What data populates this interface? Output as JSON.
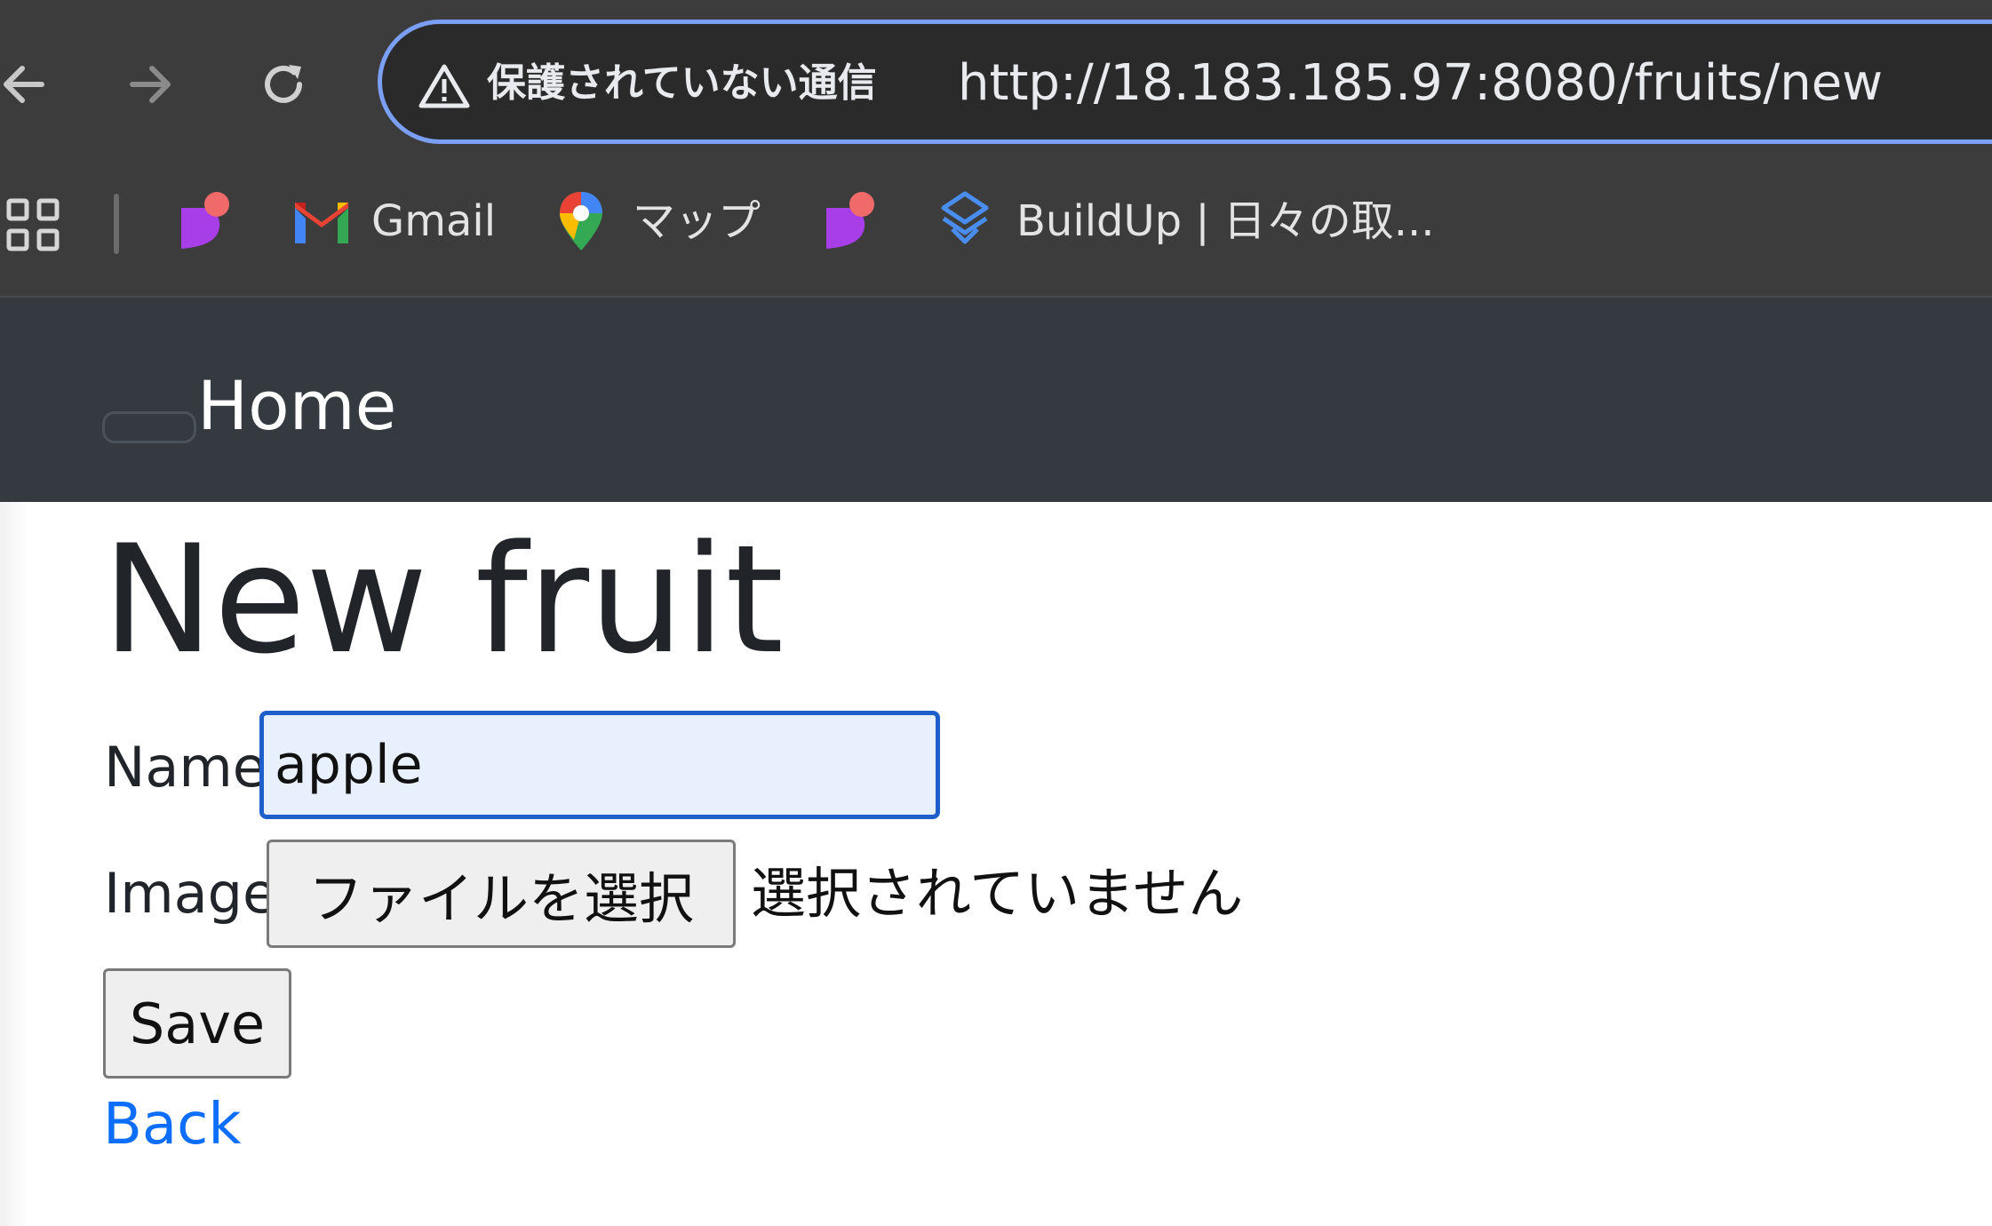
{
  "browser": {
    "address_bar": {
      "security_status": "保護されていない通信",
      "url": "http://18.183.185.97:8080/fruits/new"
    },
    "bookmarks": [
      {
        "label": "",
        "icon": "purple-app-icon"
      },
      {
        "label": "Gmail",
        "icon": "gmail-icon"
      },
      {
        "label": "マップ",
        "icon": "maps-pin-icon"
      },
      {
        "label": "",
        "icon": "purple-app-icon"
      },
      {
        "label": "BuildUp | 日々の取...",
        "icon": "buildup-icon"
      }
    ]
  },
  "navbar": {
    "brand": "Home"
  },
  "page": {
    "title": "New fruit",
    "form": {
      "name_label": "Name",
      "name_value": "apple",
      "image_label": "Image",
      "file_button_label": "ファイルを選択",
      "file_status": "選択されていません",
      "save_label": "Save"
    },
    "back_link": "Back"
  },
  "colors": {
    "toolbar_bg": "#3c3c3c",
    "omnibox_border": "#7a9ff5",
    "navbar_bg": "#343a40",
    "link": "#0d6efd",
    "input_focus_border": "#1f5fcc",
    "input_autofill_bg": "#e8f0fe"
  }
}
